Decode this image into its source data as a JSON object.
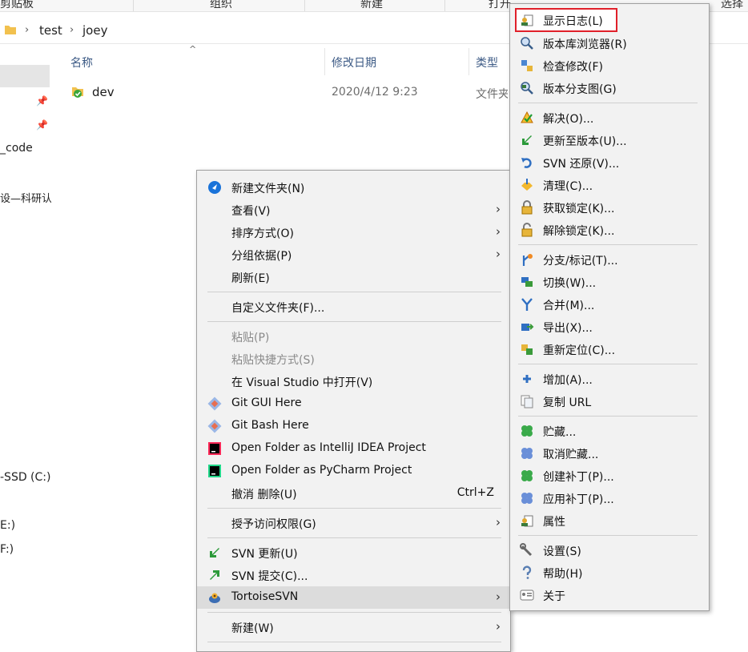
{
  "ribbon": {
    "clipboard_label": "剪贴板",
    "organize_label": "组织",
    "new_label": "新建",
    "open_label": "打开",
    "select_label": "选择"
  },
  "address": {
    "crumbs": [
      "test",
      "joey"
    ]
  },
  "nav": {
    "items": [
      "_code",
      "设—科研认",
      "-SSD (C:)",
      "E:)",
      "F:)"
    ]
  },
  "file_list": {
    "columns": [
      "名称",
      "修改日期",
      "类型"
    ],
    "rows": [
      {
        "name": "dev",
        "modified": "2020/4/12 9:23",
        "type": "文件夹"
      }
    ]
  },
  "context_menu": {
    "items": [
      {
        "label": "新建文件夹(N)",
        "icon": "new-folder-icon"
      },
      {
        "label": "查看(V)",
        "has_submenu": true
      },
      {
        "label": "排序方式(O)",
        "has_submenu": true
      },
      {
        "label": "分组依据(P)",
        "has_submenu": true
      },
      {
        "label": "刷新(E)"
      },
      {
        "label": "自定义文件夹(F)..."
      },
      {
        "label": "粘贴(P)",
        "disabled": true
      },
      {
        "label": "粘贴快捷方式(S)",
        "disabled": true
      },
      {
        "label": "在 Visual Studio 中打开(V)"
      },
      {
        "label": "Git GUI Here",
        "icon": "git-icon"
      },
      {
        "label": "Git Bash Here",
        "icon": "git-icon"
      },
      {
        "label": "Open Folder as IntelliJ IDEA Project",
        "icon": "intellij-icon"
      },
      {
        "label": "Open Folder as PyCharm Project",
        "icon": "pycharm-icon"
      },
      {
        "label": "撤消 删除(U)",
        "shortcut": "Ctrl+Z"
      },
      {
        "label": "授予访问权限(G)",
        "has_submenu": true
      },
      {
        "label": "SVN 更新(U)",
        "icon": "svn-update-icon"
      },
      {
        "label": "SVN 提交(C)...",
        "icon": "svn-commit-icon"
      },
      {
        "label": "TortoiseSVN",
        "icon": "tortoisesvn-icon",
        "has_submenu": true,
        "highlighted": true
      },
      {
        "label": "新建(W)",
        "has_submenu": true
      }
    ]
  },
  "submenu": {
    "items": [
      {
        "label": "显示日志(L)",
        "icon": "show-log-icon"
      },
      {
        "label": "版本库浏览器(R)",
        "icon": "repo-browser-icon"
      },
      {
        "label": "检查修改(F)",
        "icon": "check-modifications-icon"
      },
      {
        "label": "版本分支图(G)",
        "icon": "revision-graph-icon"
      },
      {
        "label": "解决(O)...",
        "icon": "resolve-icon"
      },
      {
        "label": "更新至版本(U)...",
        "icon": "update-to-revision-icon"
      },
      {
        "label": "SVN 还原(V)...",
        "icon": "revert-icon"
      },
      {
        "label": "清理(C)...",
        "icon": "cleanup-icon"
      },
      {
        "label": "获取锁定(K)...",
        "icon": "get-lock-icon"
      },
      {
        "label": "解除锁定(K)...",
        "icon": "release-lock-icon"
      },
      {
        "label": "分支/标记(T)...",
        "icon": "branch-tag-icon"
      },
      {
        "label": "切换(W)...",
        "icon": "switch-icon"
      },
      {
        "label": "合并(M)...",
        "icon": "merge-icon"
      },
      {
        "label": "导出(X)...",
        "icon": "export-icon"
      },
      {
        "label": "重新定位(C)...",
        "icon": "relocate-icon"
      },
      {
        "label": "增加(A)...",
        "icon": "add-icon"
      },
      {
        "label": "复制 URL",
        "icon": "copy-url-icon"
      },
      {
        "label": "贮藏...",
        "icon": "shelve-icon"
      },
      {
        "label": "取消贮藏...",
        "icon": "unshelve-icon"
      },
      {
        "label": "创建补丁(P)...",
        "icon": "create-patch-icon"
      },
      {
        "label": "应用补丁(P)...",
        "icon": "apply-patch-icon"
      },
      {
        "label": "属性",
        "icon": "properties-icon"
      },
      {
        "label": "设置(S)",
        "icon": "settings-icon"
      },
      {
        "label": "帮助(H)",
        "icon": "help-icon"
      },
      {
        "label": "关于",
        "icon": "about-icon"
      }
    ]
  }
}
